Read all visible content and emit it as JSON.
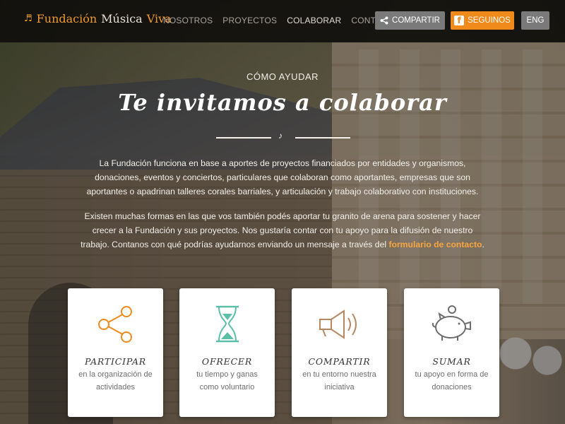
{
  "header": {
    "logo": {
      "word1": "Fundación",
      "word2": "Música",
      "word3": "Viva",
      "icon": "music-note-icon"
    },
    "nav": [
      "NOSOTROS",
      "PROYECTOS",
      "COLABORAR",
      "CONTACTO"
    ],
    "active_nav": "COLABORAR",
    "share_label": "COMPARTIR",
    "follow_label": "SEGUINOS",
    "lang_label": "ENG"
  },
  "hero": {
    "eyebrow": "CÓMO AYUDAR",
    "title": "Te invitamos a colaborar",
    "paragraph1": "La Fundación funciona en base a aportes de proyectos financiados por entidades y organismos, donaciones, eventos y conciertos, particulares que colaboran como aportantes, empresas que son aportantes o apadrinan talleres corales barriales, y articulación y trabajo colaborativo con instituciones.",
    "paragraph2_text": "Existen muchas formas en las que vos también podés aportar tu granito de arena para sostener y hacer crecer a la Fundación y sus proyectos. Nos gustaría contar con tu apoyo para la difusión de nuestro trabajo. Contanos con qué podrías ayudarnos enviando un mensaje a través del ",
    "paragraph2_link": "formulario de contacto",
    "paragraph2_end": "."
  },
  "cards": [
    {
      "title": "PARTICIPAR",
      "desc": "en la organización de actividades",
      "icon": "share-nodes-icon",
      "color": "#ef8a1b"
    },
    {
      "title": "OFRECER",
      "desc": "tu tiempo y ganas como voluntario",
      "icon": "hourglass-icon",
      "color": "#5bbfa8"
    },
    {
      "title": "COMPARTIR",
      "desc": "en tu entorno nuestra iniciativa",
      "icon": "megaphone-icon",
      "color": "#b58860"
    },
    {
      "title": "SUMAR",
      "desc": "tu apoyo en forma de donaciones",
      "icon": "piggy-bank-icon",
      "color": "#7a7a7a"
    }
  ],
  "colors": {
    "accent": "#ef8a1b",
    "link": "#f7a640"
  }
}
